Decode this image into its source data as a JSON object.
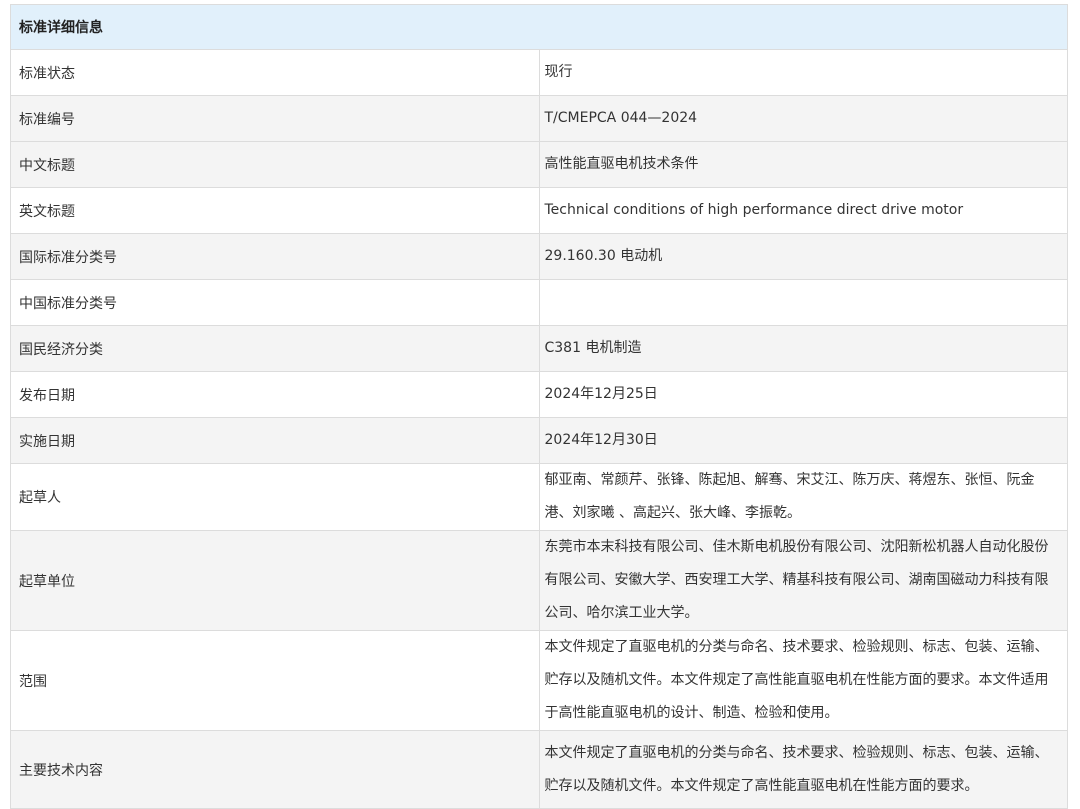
{
  "header": {
    "title": "标准详细信息"
  },
  "rows": [
    {
      "label": "标准状态",
      "value": "现行"
    },
    {
      "label": "标准编号",
      "value": "T/CMEPCA 044—2024"
    },
    {
      "label": "中文标题",
      "value": "高性能直驱电机技术条件"
    },
    {
      "label": "英文标题",
      "value": "Technical conditions of high performance direct drive motor"
    },
    {
      "label": "国际标准分类号",
      "value": "29.160.30 电动机"
    },
    {
      "label": "中国标准分类号",
      "value": ""
    },
    {
      "label": "国民经济分类",
      "value": "C381 电机制造"
    },
    {
      "label": "发布日期",
      "value": "2024年12月25日"
    },
    {
      "label": "实施日期",
      "value": "2024年12月30日"
    },
    {
      "label": "起草人",
      "value": "郁亚南、常颜芹、张锋、陈起旭、解骞、宋艾江、陈万庆、蒋煜东、张恒、阮金港、刘家曦 、高起兴、张大峰、李振乾。"
    },
    {
      "label": "起草单位",
      "value": "东莞市本末科技有限公司、佳木斯电机股份有限公司、沈阳新松机器人自动化股份有限公司、安徽大学、西安理工大学、精基科技有限公司、湖南国磁动力科技有限公司、哈尔滨工业大学。"
    },
    {
      "label": "范围",
      "value": "本文件规定了直驱电机的分类与命名、技术要求、检验规则、标志、包装、运输、贮存以及随机文件。本文件规定了高性能直驱电机在性能方面的要求。本文件适用于高性能直驱电机的设计、制造、检验和使用。"
    },
    {
      "label": "主要技术内容",
      "value": "本文件规定了直驱电机的分类与命名、技术要求、检验规则、标志、包装、运输、贮存以及随机文件。本文件规定了高性能直驱电机在性能方面的要求。"
    }
  ]
}
